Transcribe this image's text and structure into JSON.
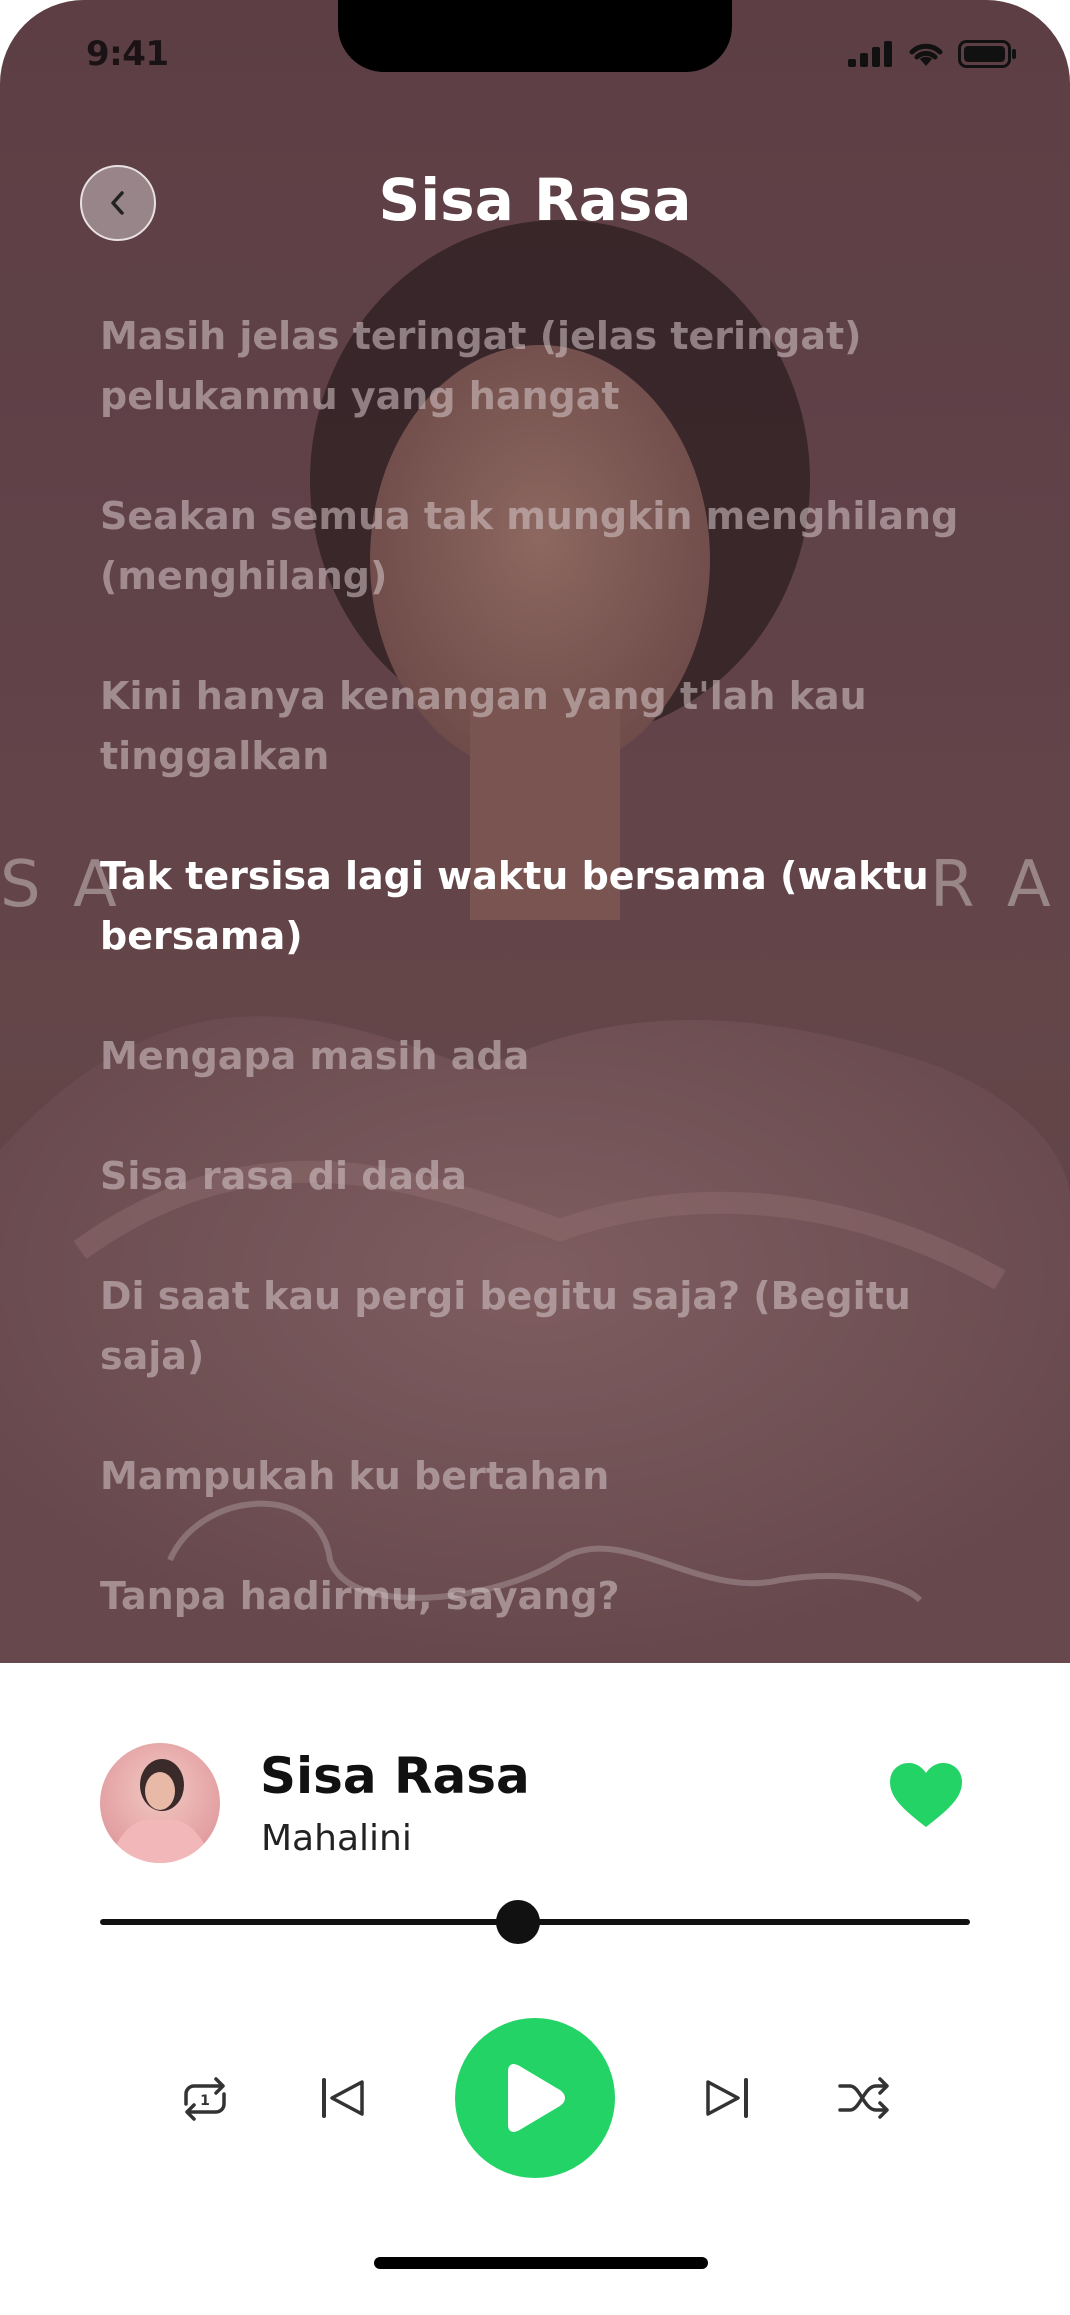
{
  "status_bar": {
    "time": "9:41"
  },
  "header": {
    "title": "Sisa Rasa"
  },
  "artwork": {
    "watermark_left": "S A",
    "watermark_right": "R A"
  },
  "lyrics": {
    "lines": [
      "Masih jelas teringat (jelas teringat) pelukanmu yang hangat",
      "Seakan semua tak mungkin menghilang (menghilang)",
      "Kini hanya kenangan yang t'lah kau tinggalkan",
      "Tak tersisa lagi waktu bersama (waktu bersama)",
      "Mengapa masih ada",
      "Sisa rasa di dada",
      "Di saat kau pergi begitu saja? (Begitu saja)",
      "Mampukah ku bertahan",
      "Tanpa hadirmu, sayang?"
    ],
    "active_index": 3
  },
  "player": {
    "title": "Sisa Rasa",
    "artist": "Mahalini",
    "liked": true,
    "progress": 0.48,
    "repeat_count": "1"
  },
  "colors": {
    "accent": "#23d366",
    "heart": "#23d366"
  },
  "icons": [
    "back-icon",
    "repeat-one-icon",
    "previous-icon",
    "play-icon",
    "next-icon",
    "shuffle-icon",
    "heart-icon"
  ]
}
